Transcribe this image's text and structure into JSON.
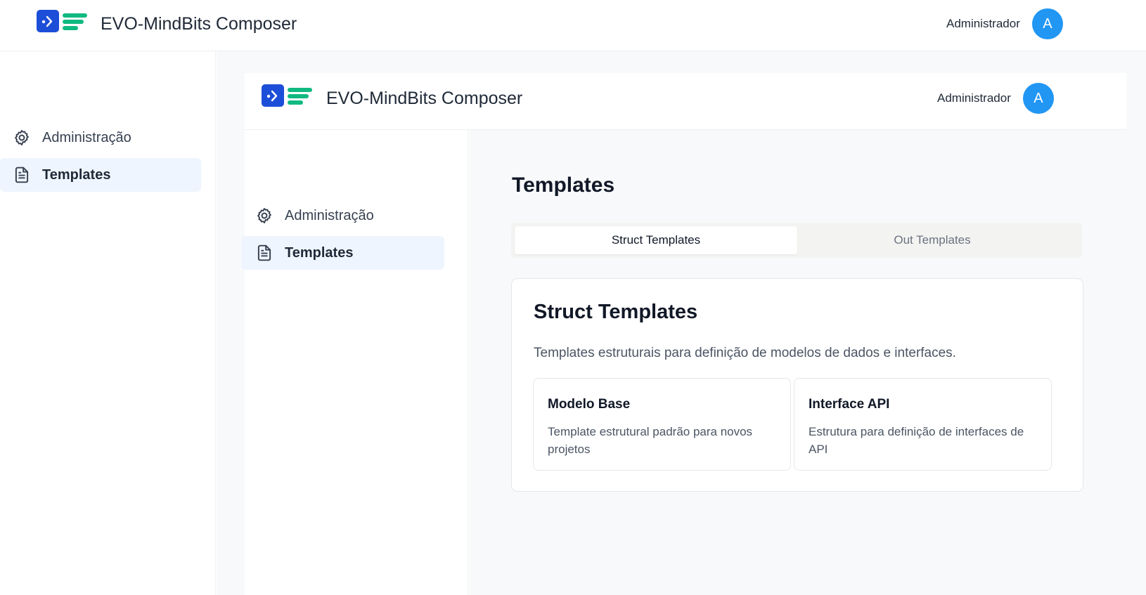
{
  "app": {
    "title": "EVO-MindBits Composer",
    "logo_icon": "terminal-prompt-icon",
    "brand_colors": {
      "logo_blue": "#1d4ed8",
      "logo_green": "#10b981",
      "avatar": "#2196f3",
      "active_nav_bg": "#eef5fe"
    }
  },
  "header": {
    "user_name": "Administrador",
    "avatar_letter": "A"
  },
  "sidebar": {
    "items": [
      {
        "label": "Administração",
        "icon": "gear-icon",
        "active": false
      },
      {
        "label": "Templates",
        "icon": "document-icon",
        "active": true
      }
    ]
  },
  "main": {
    "page_title": "Templates",
    "tabs": [
      {
        "label": "Struct Templates",
        "active": true
      },
      {
        "label": "Out Templates",
        "active": false
      }
    ],
    "card": {
      "title": "Struct Templates",
      "description": "Templates estruturais para definição de modelos de dados e interfaces.",
      "templates": [
        {
          "name": "Modelo Base",
          "description": "Template estrutural padrão para novos projetos"
        },
        {
          "name": "Interface API",
          "description": "Estrutura para definição de interfaces de API"
        }
      ]
    }
  }
}
